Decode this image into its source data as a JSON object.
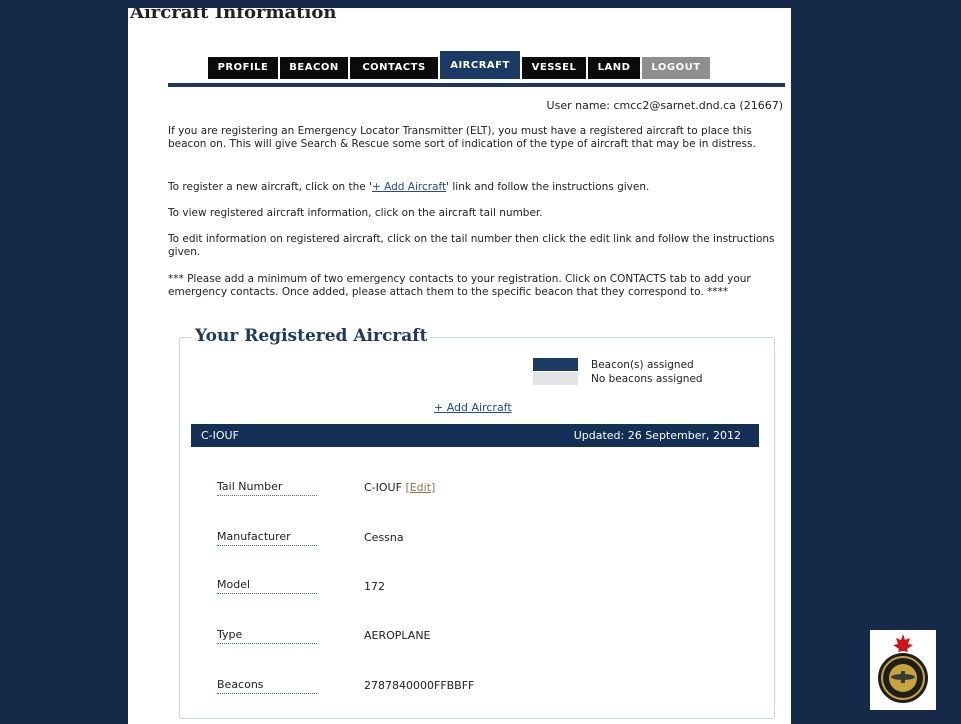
{
  "page_title": "Aircraft Information",
  "tabs": [
    {
      "label": "PROFILE"
    },
    {
      "label": "BEACON"
    },
    {
      "label": "CONTACTS"
    },
    {
      "label": "AIRCRAFT"
    },
    {
      "label": "VESSEL"
    },
    {
      "label": "LAND"
    },
    {
      "label": "LOGOUT"
    }
  ],
  "active_tab": "AIRCRAFT",
  "user": {
    "line": "User name: cmcc2@sarnet.dnd.ca (21667)"
  },
  "intro": {
    "p1": "If you are registering an Emergency Locator Transmitter (ELT), you must have a registered aircraft to place this beacon on. This will give Search & Rescue some sort of indication of the type of aircraft that may be in distress.",
    "p2_before": "To register a new aircraft, click on the '",
    "p2_link": "+ Add Aircraft",
    "p2_after": "' link and follow the instructions given.",
    "p3": "To view registered aircraft information, click on the aircraft tail number.",
    "p4": "To edit information on registered aircraft, click on the tail number then click the edit link and follow the instructions given.",
    "p5": "*** Please add a minimum of two emergency contacts to your registration. Click on CONTACTS tab to add your emergency contacts. Once added, please attach them to the specific beacon that they correspond to. ****"
  },
  "registered": {
    "legend": "Your Registered Aircraft",
    "key_assigned": "Beacon(s) assigned",
    "key_none": "No beacons assigned",
    "add_link": "+ Add Aircraft",
    "aircraft": {
      "tail": "C-IOUF",
      "updated": "Updated: 26 September, 2012",
      "tail_label": "Tail Number",
      "tail_value": "C-IOUF",
      "edit_label": "Edit",
      "manufacturer_label": "Manufacturer",
      "manufacturer_value": "Cessna",
      "model_label": "Model",
      "model_value": "172",
      "type_label": "Type",
      "type_value": "AEROPLANE",
      "beacons_label": "Beacons",
      "beacons_value": "2787840000FFBBFF"
    }
  },
  "colors": {
    "background": "#142a48",
    "accent": "#1b3a66",
    "tab": "#0b0b0b",
    "logout_tab": "#8e8e8e",
    "no_beacon": "#e4e4e4",
    "link": "#1d4aa3"
  }
}
